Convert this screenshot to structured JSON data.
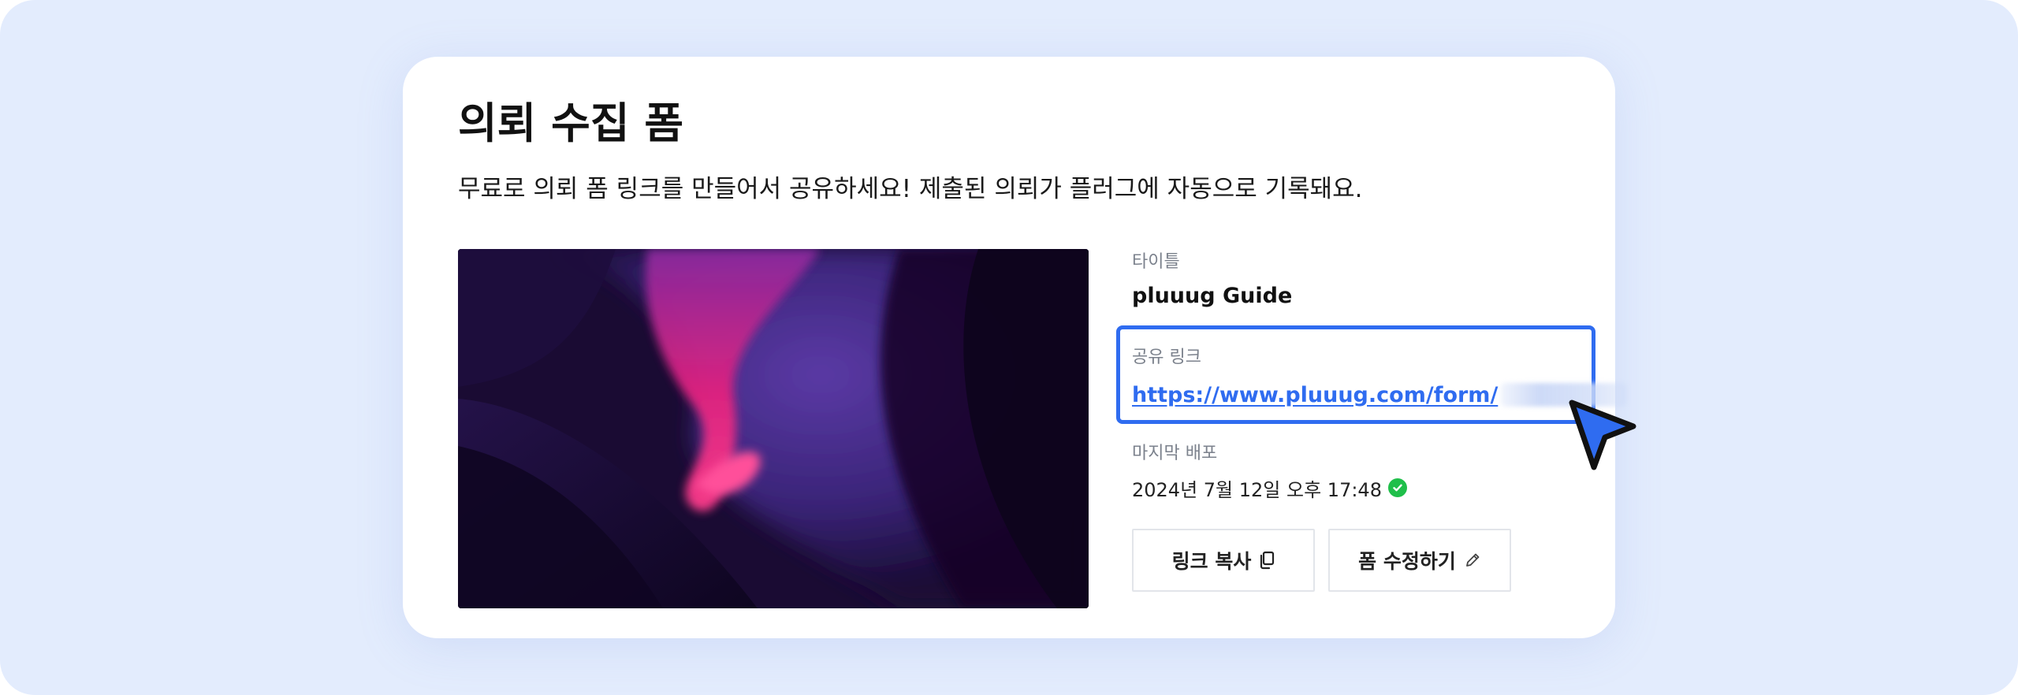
{
  "form": {
    "title": "의뢰 수집 폼",
    "description": "무료로 의뢰 폼 링크를 만들어서 공유하세요! 제출된 의뢰가 플러그에 자동으로 기록돼요."
  },
  "details": {
    "title_label": "타이틀",
    "title_value": "pluuug Guide",
    "link_label": "공유 링크",
    "link_url": "https://www.pluuug.com/form/",
    "deploy_label": "마지막 배포",
    "deploy_value": "2024년 7월 12일 오후 17:48"
  },
  "actions": {
    "copy_label": "링크 복사",
    "edit_label": "폼 수정하기"
  },
  "icons": {
    "copy": "copy-icon",
    "edit": "pencil-icon",
    "status": "check-circle-icon",
    "pointer": "cursor-arrow-icon"
  },
  "colors": {
    "page_background": "#e3ecfd",
    "accent": "#2f6cf0",
    "success": "#1fbf4a"
  }
}
